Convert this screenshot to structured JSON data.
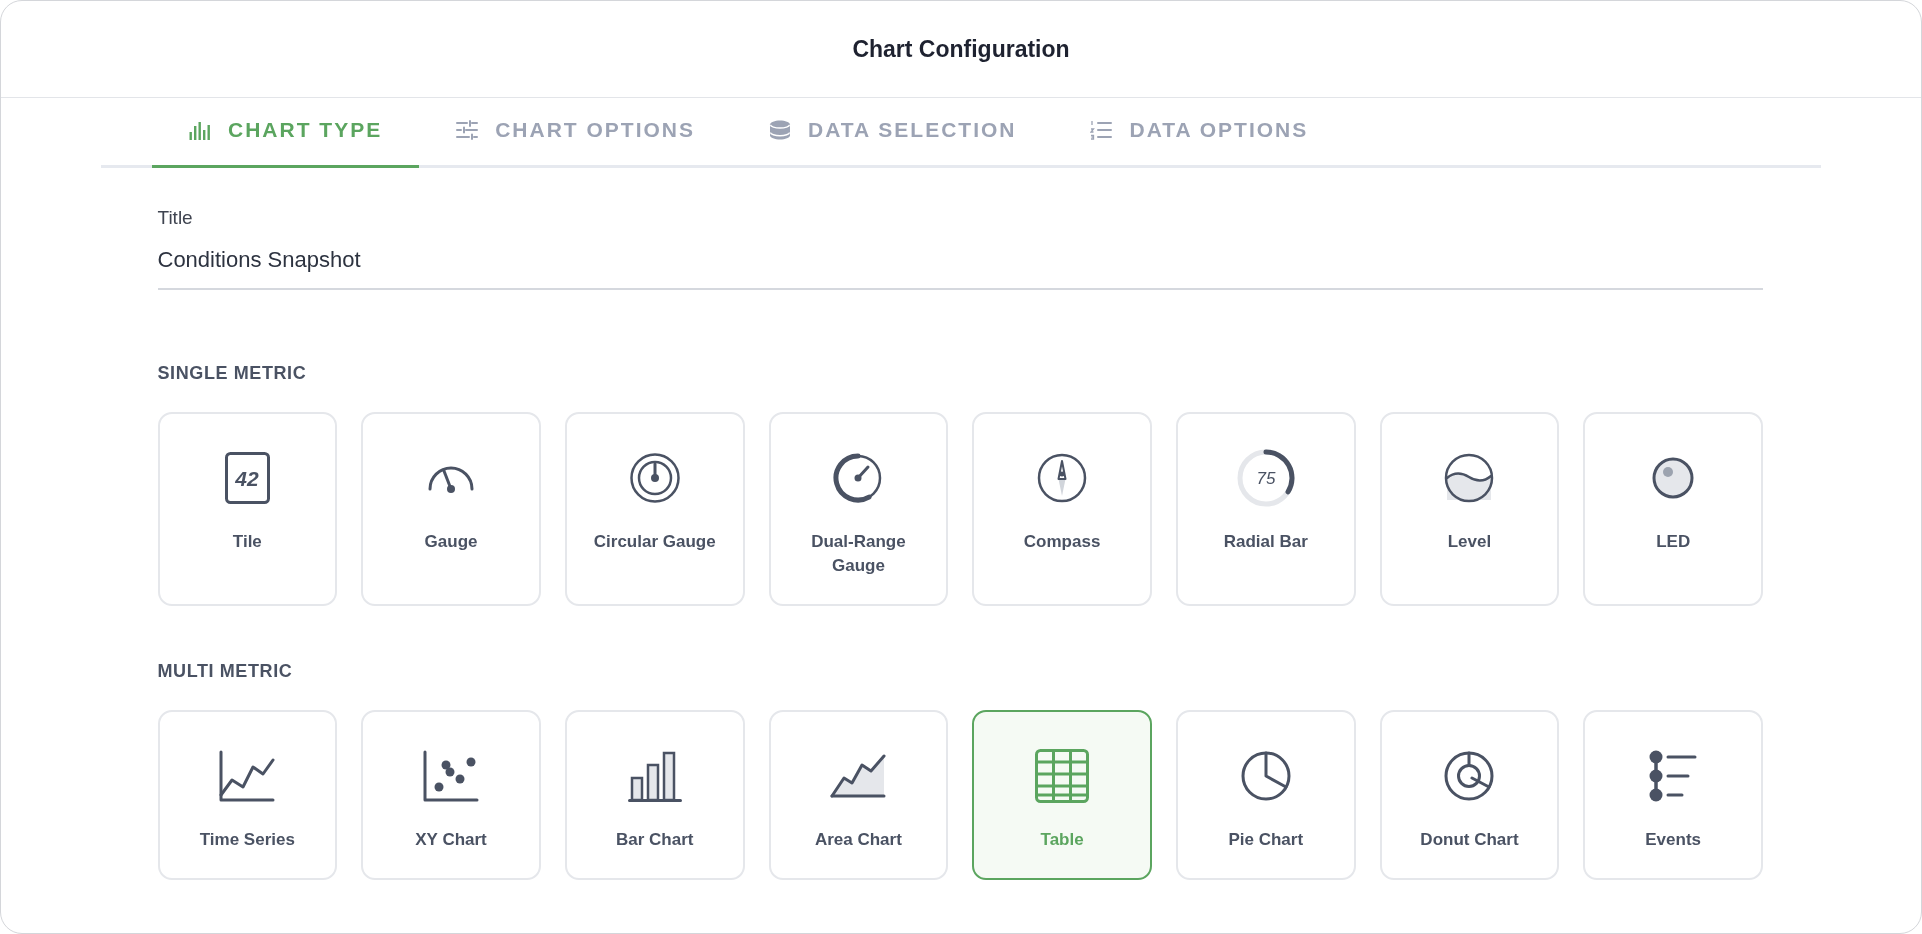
{
  "dialog": {
    "title": "Chart Configuration"
  },
  "tabs": [
    {
      "label": "CHART TYPE",
      "kind": "bars",
      "selected": true
    },
    {
      "label": "CHART OPTIONS",
      "kind": "sliders",
      "selected": false
    },
    {
      "label": "DATA SELECTION",
      "kind": "database",
      "selected": false
    },
    {
      "label": "DATA OPTIONS",
      "kind": "numbered-list",
      "selected": false
    }
  ],
  "title_field": {
    "label": "Title",
    "value": "Conditions Snapshot"
  },
  "sections": [
    {
      "heading": "SINGLE METRIC",
      "items": [
        {
          "label": "Tile",
          "kind": "tile",
          "glyph": "42",
          "selected": false
        },
        {
          "label": "Gauge",
          "kind": "gauge",
          "selected": false
        },
        {
          "label": "Circular Gauge",
          "kind": "circular-gauge",
          "selected": false
        },
        {
          "label": "Dual-Range Gauge",
          "kind": "dual-range-gauge",
          "selected": false
        },
        {
          "label": "Compass",
          "kind": "compass",
          "selected": false
        },
        {
          "label": "Radial Bar",
          "kind": "radial-bar",
          "glyph": "75",
          "selected": false
        },
        {
          "label": "Level",
          "kind": "level",
          "selected": false
        },
        {
          "label": "LED",
          "kind": "led",
          "selected": false
        }
      ]
    },
    {
      "heading": "MULTI METRIC",
      "items": [
        {
          "label": "Time Series",
          "kind": "time-series",
          "selected": false
        },
        {
          "label": "XY Chart",
          "kind": "xy-chart",
          "selected": false
        },
        {
          "label": "Bar Chart",
          "kind": "bar-chart",
          "selected": false
        },
        {
          "label": "Area Chart",
          "kind": "area-chart",
          "selected": false
        },
        {
          "label": "Table",
          "kind": "table",
          "selected": true
        },
        {
          "label": "Pie Chart",
          "kind": "pie-chart",
          "selected": false
        },
        {
          "label": "Donut Chart",
          "kind": "donut-chart",
          "selected": false
        },
        {
          "label": "Events",
          "kind": "events",
          "selected": false
        }
      ]
    }
  ]
}
